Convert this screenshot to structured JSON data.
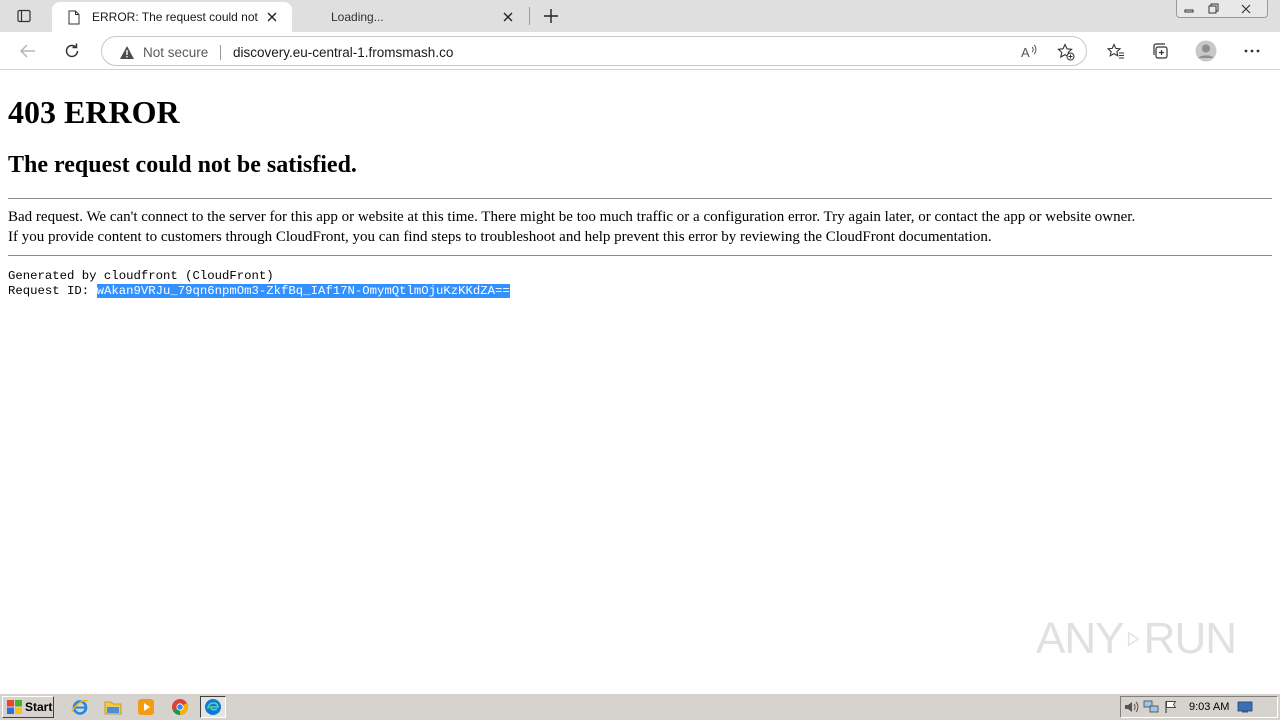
{
  "browser": {
    "tabs": [
      {
        "title": "ERROR: The request could not b",
        "active": true
      },
      {
        "title": "Loading...",
        "active": false
      }
    ],
    "address": {
      "security_label": "Not secure",
      "url": "discovery.eu-central-1.fromsmash.co"
    }
  },
  "page": {
    "heading": "403 ERROR",
    "subheading": "The request could not be satisfied.",
    "para1": "Bad request. We can't connect to the server for this app or website at this time. There might be too much traffic or a configuration error. Try again later, or contact the app or website owner.",
    "para2": "If you provide content to customers through CloudFront, you can find steps to troubleshoot and help prevent this error by reviewing the CloudFront documentation.",
    "generated_by": "Generated by cloudfront (CloudFront)",
    "request_id_label": "Request ID: ",
    "request_id": "wAkan9VRJu_79qn6npmOm3-ZkfBq_IAf17N-OmymQtlmOjuKzKKdZA=="
  },
  "watermark": {
    "left": "ANY",
    "right": "RUN"
  },
  "taskbar": {
    "start_label": "Start",
    "clock": "9:03 AM",
    "apps": [
      "ie-icon",
      "explorer-icon",
      "media-player-icon",
      "chrome-icon",
      "edge-icon"
    ]
  },
  "colors": {
    "selection": "#3390ff",
    "tabstrip": "#dfdfdf",
    "taskbar": "#d6d3ce"
  }
}
